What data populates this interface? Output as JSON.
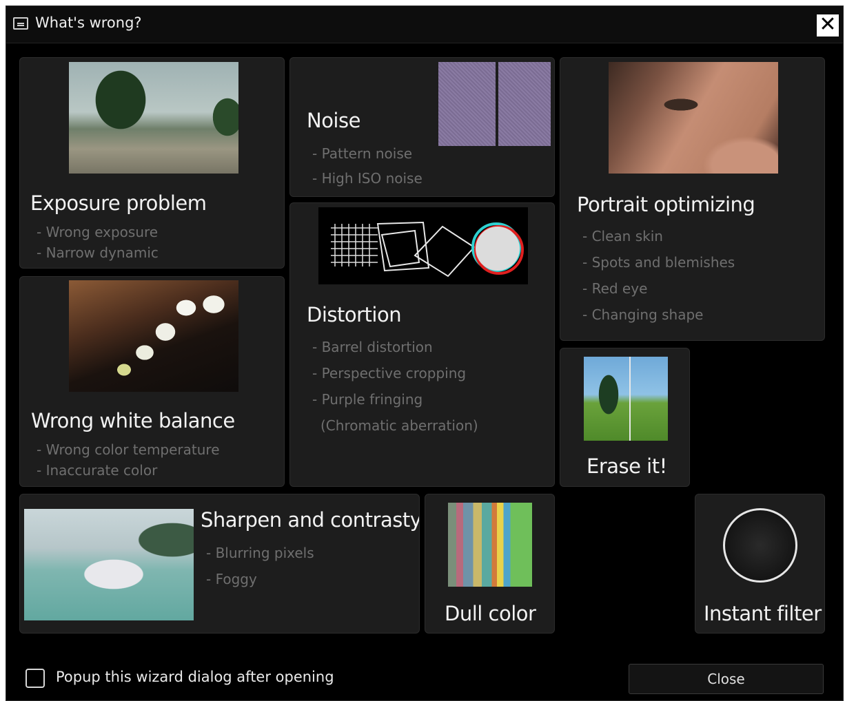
{
  "window": {
    "title": "What's wrong?",
    "close_glyph": "✕"
  },
  "tiles": {
    "exposure": {
      "title": "Exposure problem",
      "items": [
        "- Wrong exposure",
        "- Narrow dynamic"
      ]
    },
    "noise": {
      "title": "Noise",
      "items": [
        "- Pattern noise",
        "- High ISO noise"
      ]
    },
    "portrait": {
      "title": "Portrait optimizing",
      "items": [
        "- Clean skin",
        "- Spots and blemishes",
        "- Red eye",
        "- Changing shape"
      ]
    },
    "distortion": {
      "title": "Distortion",
      "items": [
        "- Barrel distortion",
        "- Perspective cropping",
        "- Purple fringing",
        "(Chromatic aberration)"
      ]
    },
    "white_balance": {
      "title": "Wrong white balance",
      "items": [
        "- Wrong color temperature",
        "- Inaccurate color"
      ]
    },
    "erase": {
      "title": "Erase it!"
    },
    "sharpen": {
      "title": "Sharpen and contrasty",
      "items": [
        "- Blurring pixels",
        "- Foggy"
      ]
    },
    "dull": {
      "title": "Dull color"
    },
    "instant": {
      "title": "Instant filter"
    }
  },
  "footer": {
    "checkbox_label": "Popup this wizard dialog after opening",
    "checkbox_checked": false,
    "close_label": "Close"
  }
}
